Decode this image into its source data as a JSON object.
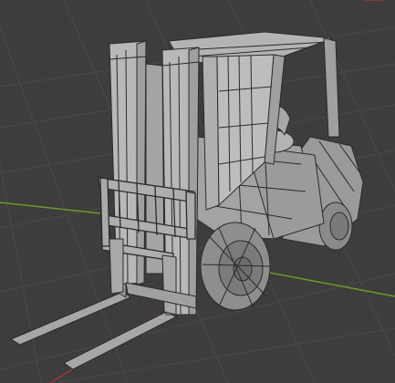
{
  "viewport": {
    "background": "#3d3d3d",
    "grid_color": "#4a4a4a",
    "x_axis_color": "#9c3a3a",
    "y_axis_color": "#6b9a2a"
  },
  "model": {
    "name": "forklift-wireframe",
    "shading": "solid-wireframe",
    "body_color": "#a9a9a9",
    "edge_color": "#2b2b2b"
  }
}
